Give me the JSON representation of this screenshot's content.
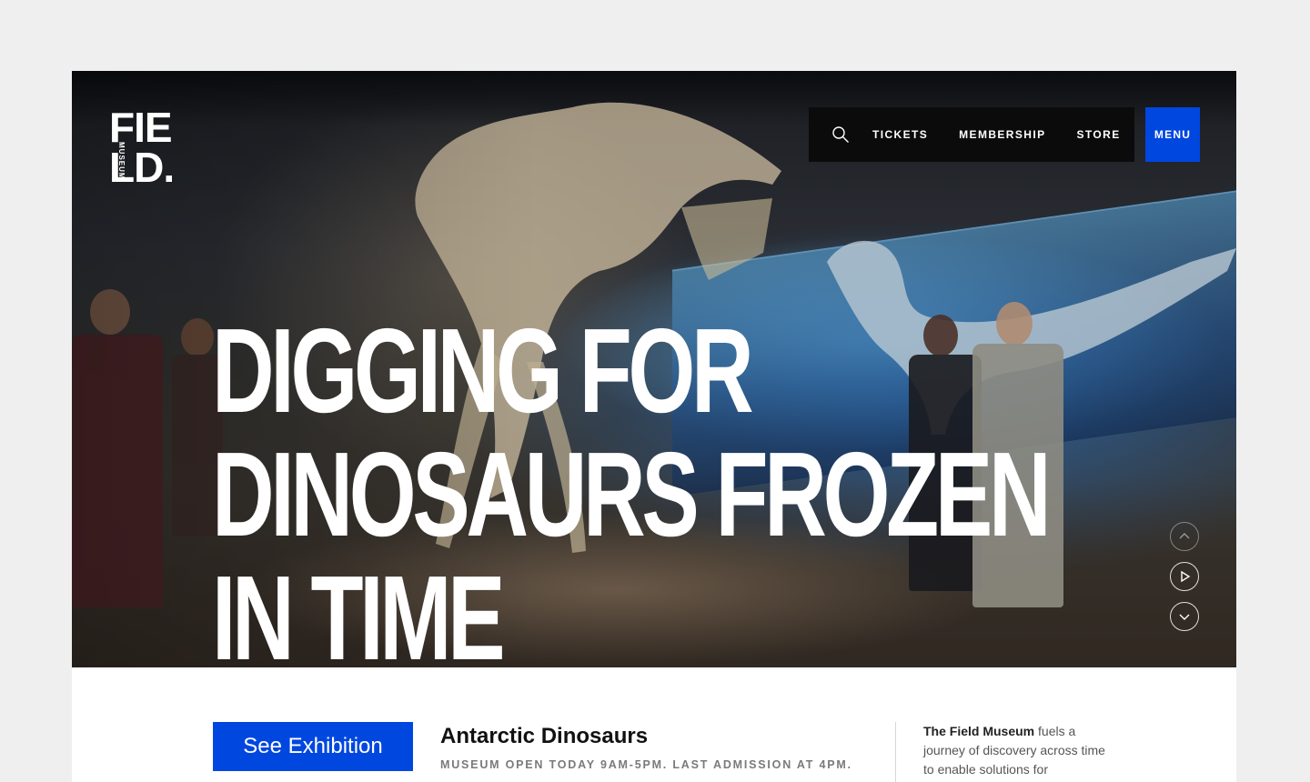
{
  "logo": {
    "line1": "FIE",
    "line2": "LD.",
    "sub": "MUSEUM"
  },
  "nav": {
    "search_icon": "search-icon",
    "links": [
      "TICKETS",
      "MEMBERSHIP",
      "STORE"
    ],
    "menu_label": "MENU"
  },
  "hero": {
    "headline": "DIGGING FOR DINOSAURS FROZEN IN TIME",
    "controls": [
      "chevron-up-icon",
      "play-icon",
      "chevron-down-icon"
    ]
  },
  "exhibit": {
    "cta_label": "See Exhibition",
    "title": "Antarctic Dinosaurs",
    "hours": "MUSEUM OPEN TODAY 9AM-5PM. LAST ADMISSION AT 4PM."
  },
  "about": {
    "strong": "The Field Museum",
    "text": " fuels a journey of discovery across time to enable solutions for"
  },
  "colors": {
    "accent": "#0047e0",
    "nav_bg": "#0b0b0b",
    "page_bg": "#efefef"
  }
}
